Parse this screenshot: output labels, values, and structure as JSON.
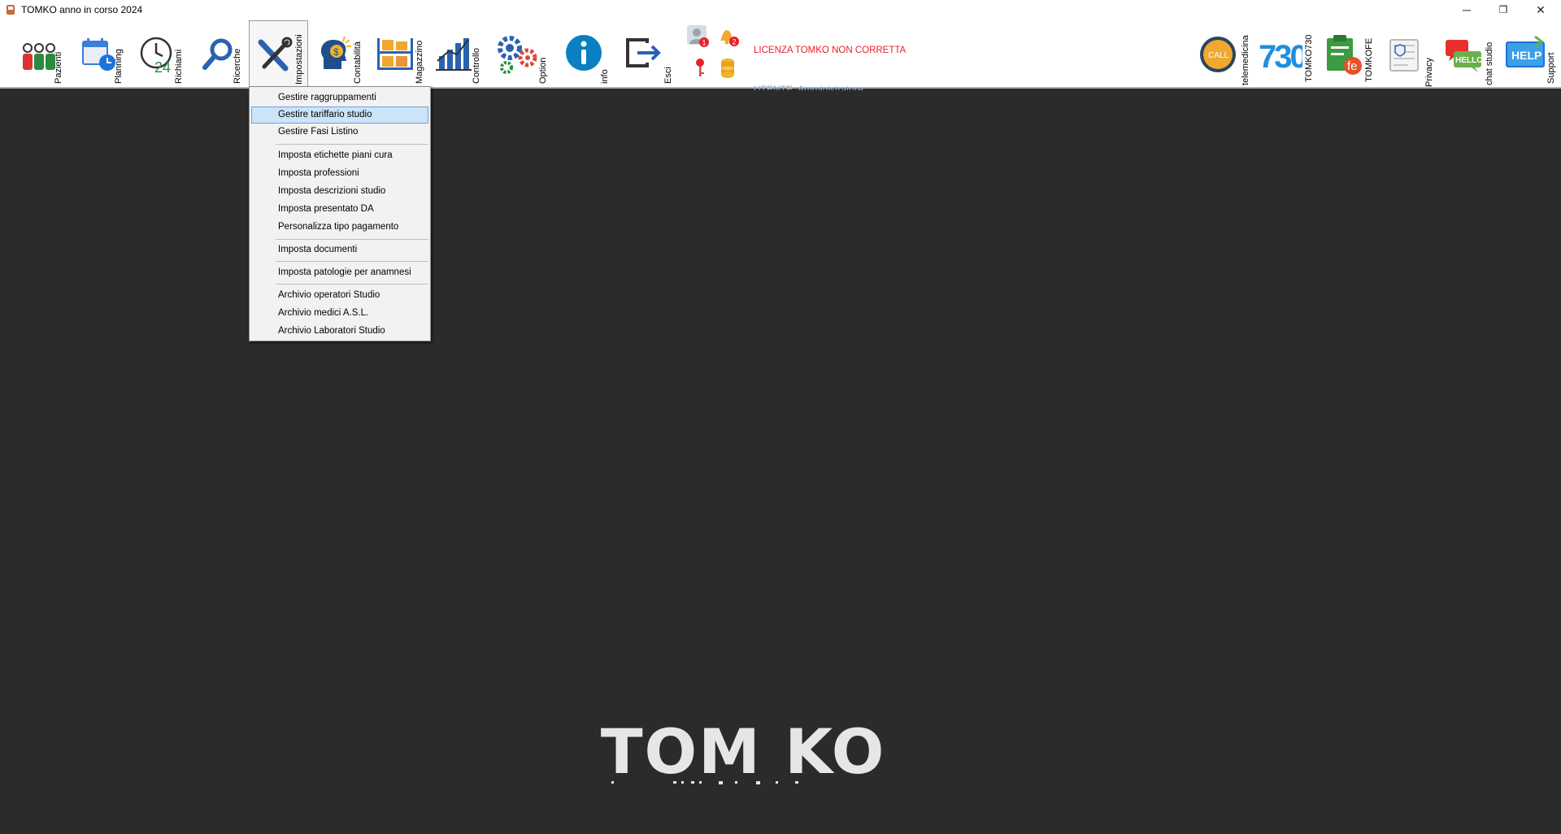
{
  "window": {
    "title": "TOMKO anno in corso 2024",
    "controls": [
      "─",
      "❐",
      "✕"
    ]
  },
  "toolbar": {
    "buttons": [
      {
        "label": "Pazienti",
        "icon": "patients-icon"
      },
      {
        "label": "Planning",
        "icon": "calendar-clock-icon"
      },
      {
        "label": "Richiami",
        "icon": "recall-24-icon"
      },
      {
        "label": "Ricerche",
        "icon": "magnifier-icon"
      },
      {
        "label": "Impostazioni",
        "icon": "tools-icon"
      },
      {
        "label": "Contabilità",
        "icon": "accounting-head-icon"
      },
      {
        "label": "Magazzino",
        "icon": "warehouse-shelves-icon"
      },
      {
        "label": "Controllo",
        "icon": "bar-chart-icon"
      },
      {
        "label": "Option",
        "icon": "gears-icon"
      },
      {
        "label": "info",
        "icon": "info-icon"
      },
      {
        "label": "Esci",
        "icon": "exit-icon"
      }
    ],
    "status_icons": {
      "user_badge": "1",
      "bell_badge": "2"
    },
    "license_warning": "LICENZA TOMKO NON CORRETTA",
    "user_text": "UTENTE: Amministratore",
    "right_buttons": [
      {
        "label": "telemedicina",
        "icon": "call-icon",
        "text": "CALL"
      },
      {
        "label": "TOMKO730",
        "icon": "730-icon",
        "text": "730"
      },
      {
        "label": "TOMKOFE",
        "icon": "fe-invoice-icon",
        "text": "fe"
      },
      {
        "label": "Privacy",
        "icon": "privacy-document-icon"
      },
      {
        "label": "chat studio",
        "icon": "chat-bubbles-icon",
        "text": "HELLO"
      },
      {
        "label": "Support",
        "icon": "help-icon",
        "text": "HELP"
      }
    ]
  },
  "menu": {
    "items": [
      {
        "label": "Gestire raggruppamenti"
      },
      {
        "label": "Gestire tariffario studio",
        "highlighted": true
      },
      {
        "label": "Gestire Fasi Listino"
      },
      {
        "label": "Imposta etichette piani cura"
      },
      {
        "label": "Imposta professioni"
      },
      {
        "label": "Imposta descrizioni studio"
      },
      {
        "label": "Imposta presentato DA"
      },
      {
        "label": "Personalizza tipo pagamento"
      },
      {
        "label": "Imposta documenti"
      },
      {
        "label": "Imposta patologie per anamnesi"
      },
      {
        "label": "Archivio operatori Studio"
      },
      {
        "label": "Archivio medici A.S.L."
      },
      {
        "label": "Archivio Laboratori Studio"
      }
    ]
  },
  "logo": {
    "text": "TOM KO"
  },
  "colors": {
    "workspace_bg": "#2b2b2b",
    "license_red": "#e8202a",
    "user_blue": "#87aacf",
    "menu_highlight": "#cce4f7"
  }
}
